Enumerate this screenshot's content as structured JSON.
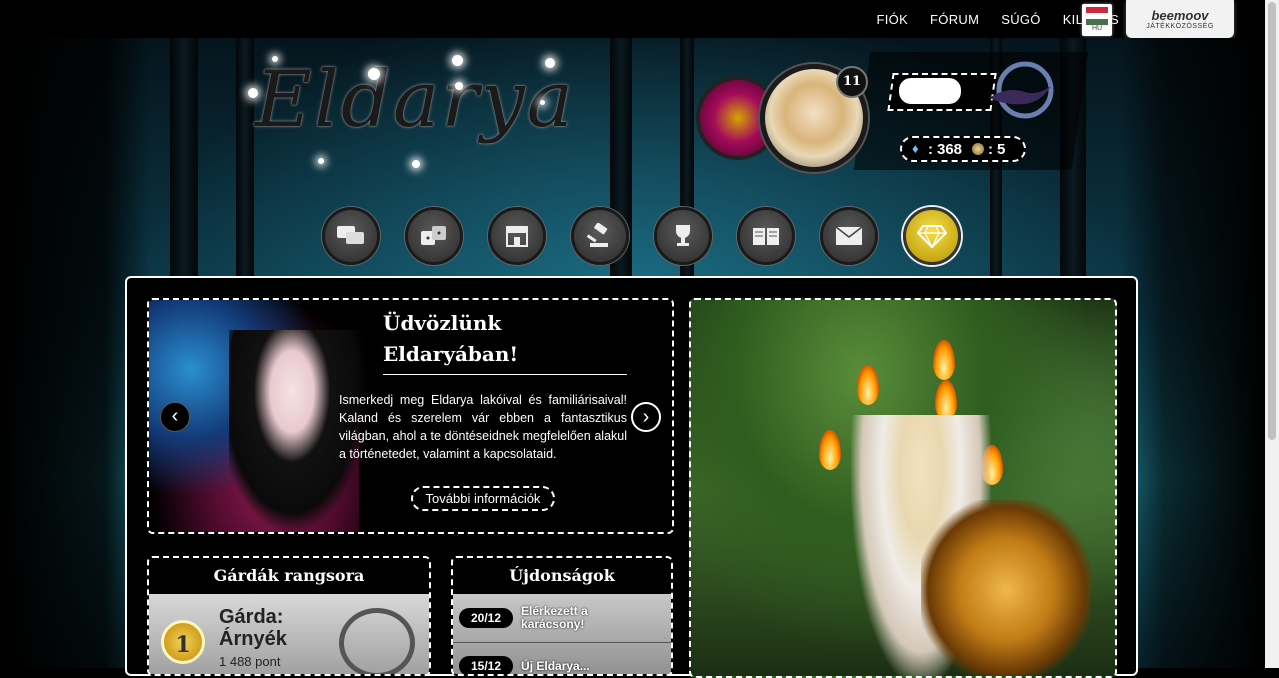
{
  "topnav": {
    "items": [
      "FIÓK",
      "FÓRUM",
      "SÚGÓ",
      "KILÉPÉS"
    ]
  },
  "language": {
    "code": "HU",
    "flag_colors": [
      "#ce2939",
      "#ffffff",
      "#477050"
    ]
  },
  "beemoov": {
    "logo": "beemoov",
    "sub": "JÁTÉKKÖZÖSSÉG"
  },
  "brand": {
    "title": "Eldarya"
  },
  "player": {
    "level": "11",
    "maana": "368",
    "gold": "5"
  },
  "mainnav": {
    "icons": [
      "chat-icon",
      "dice-icon",
      "shop-icon",
      "auction-gavel-icon",
      "trophy-icon",
      "book-icon",
      "mail-icon",
      "diamond-icon"
    ]
  },
  "slider": {
    "title": "Üdvözlünk Eldaryában!",
    "text": "Ismerkedj meg Eldarya lakóival és familiárisaival! Kaland és szerelem vár ebben a fantasztikus világban, ahol a te döntéseidnek megfelelően alakul a történetedet, valamint a kapcsolataid.",
    "button": "További információk",
    "prev": "‹",
    "next": "›"
  },
  "guards": {
    "title": "Gárdák rangsora",
    "rank": "1",
    "name": "Gárda: Árnyék",
    "points": "1 488 pont"
  },
  "news": {
    "title": "Újdonságok",
    "items": [
      {
        "date": "20/12",
        "text": "Elérkezett a karácsony!"
      },
      {
        "date": "15/12",
        "text": "Új Eldarya..."
      }
    ]
  },
  "colors": {
    "accent_gold": "#e8c400",
    "maana_blue": "#5dc8ff"
  }
}
